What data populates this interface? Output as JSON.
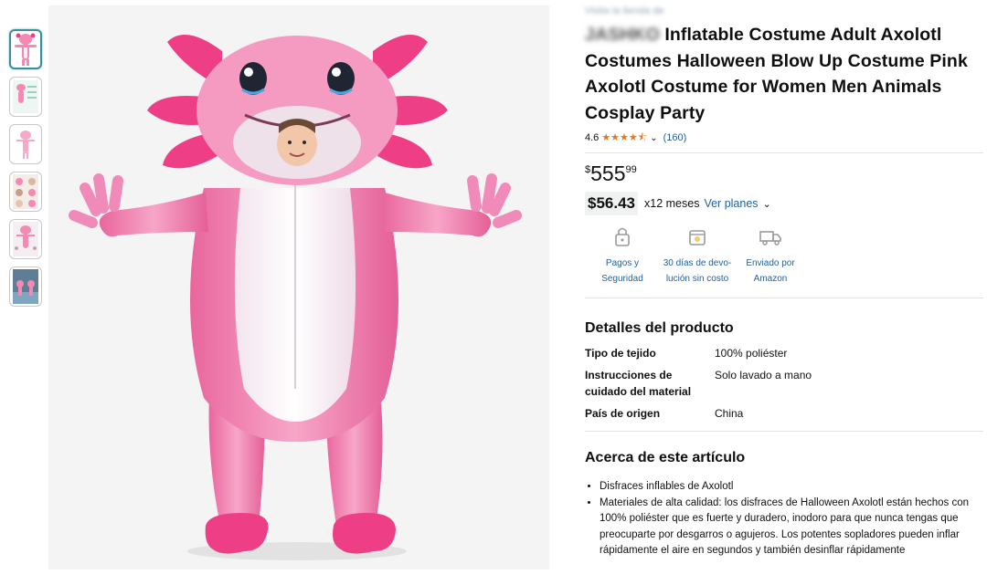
{
  "thumbnails": [
    {
      "name": "thumbnail-1",
      "active": true
    },
    {
      "name": "thumbnail-2",
      "active": false
    },
    {
      "name": "thumbnail-3",
      "active": false
    },
    {
      "name": "thumbnail-4",
      "active": false
    },
    {
      "name": "thumbnail-5",
      "active": false
    },
    {
      "name": "thumbnail-6",
      "active": false
    }
  ],
  "product": {
    "store_link": "Visita la tienda de",
    "brand": "JASHKO",
    "title": "Inflatable Costume Adult Axolotl Costumes Halloween Blow Up Costume Pink Axolotl Costume for Women Men Animals Cosplay Party",
    "rating": "4.6",
    "stars": 4.5,
    "reviews": "(160)",
    "price_symbol": "$",
    "price_whole": "555",
    "price_fraction": "99",
    "installment_amount": "$56.43",
    "installment_text": "x12 meses",
    "installment_link": "Ver planes"
  },
  "features": [
    {
      "icon": "lock-icon",
      "label_line1": "Pagos y",
      "label_line2": "Seguridad"
    },
    {
      "icon": "return-box-icon",
      "label_line1": "30 días de devo-",
      "label_line2": "lución sin costo"
    },
    {
      "icon": "truck-icon",
      "label_line1": "Enviado por",
      "label_line2": "Amazon"
    }
  ],
  "details": {
    "title": "Detalles del producto",
    "rows": [
      {
        "key_line1": "Tipo de tejido",
        "key_line2": "",
        "value": "100% poliéster"
      },
      {
        "key_line1": "Instrucciones de",
        "key_line2": "cuidado del material",
        "value": "Solo lavado a mano"
      },
      {
        "key_line1": "País de origen",
        "key_line2": "",
        "value": "China"
      }
    ]
  },
  "about": {
    "title": "Acerca de este artículo",
    "bullets": [
      "Disfraces inflables de Axolotl",
      "Materiales de alta calidad: los disfraces de Halloween Axolotl están hechos con 100% poliéster que es fuerte y duradero, inodoro para que nunca tengas que preocuparte por desgarros o agujeros. Los potentes sopladores pueden inflar rápidamente el aire en segundos y también desinflar rápidamente"
    ]
  },
  "colors": {
    "link": "#2162a1",
    "star": "#de7921",
    "costume_pink": "#f48ab4",
    "gill_pink": "#ee3f86",
    "belly": "#f6eef4"
  }
}
